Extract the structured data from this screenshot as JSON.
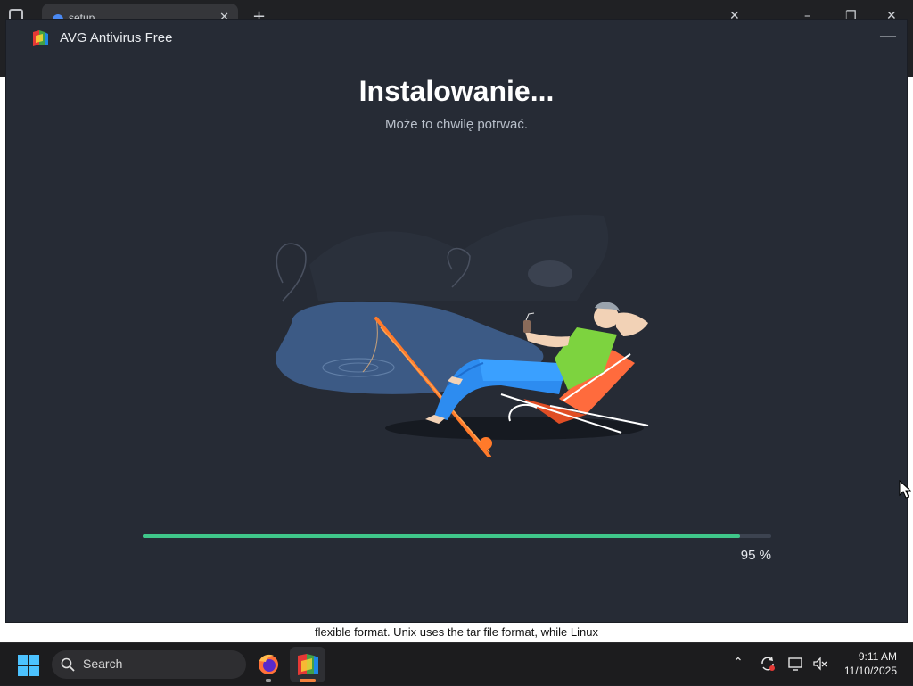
{
  "background": {
    "tab_title": "setup",
    "document_line": "flexible format. Unix uses the tar file format, while Linux"
  },
  "window": {
    "title": "AVG Antivirus Free",
    "minimize_icon": "minimize-icon",
    "logo_icon": "avg-logo-icon"
  },
  "install": {
    "heading": "Instalowanie...",
    "subheading": "Może to chwilę potrwać.",
    "progress_percent": 95,
    "progress_label": "95 %",
    "accent_color": "#3fc78a"
  },
  "taskbar": {
    "search_placeholder": "Search",
    "apps": [
      "firefox-icon",
      "avg-installer-icon"
    ],
    "tray_icons": [
      "chevron-up-icon",
      "sync-icon",
      "display-icon",
      "volume-muted-icon"
    ],
    "time": "9:11 AM",
    "date": "11/10/2025"
  }
}
